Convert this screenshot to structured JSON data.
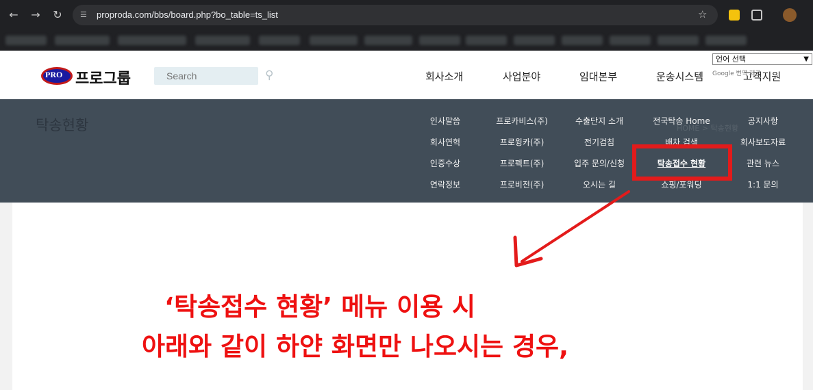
{
  "browser": {
    "url": "proproda.com/bbs/board.php?bo_table=ts_list",
    "icons": [
      "back-icon",
      "forward-icon",
      "reload-icon",
      "site-info-icon",
      "star-icon",
      "extension-icon",
      "profile-icon"
    ]
  },
  "header": {
    "logo_badge": "PRO",
    "logo_text": "프로그룹",
    "search_placeholder": "Search",
    "nav": [
      "회사소개",
      "사업분야",
      "임대본부",
      "운송시스템",
      "고객지원"
    ],
    "language_select": "언어 선택",
    "google_translate": "Google 번역 제공"
  },
  "subnav": {
    "page_title": "탁송현황",
    "breadcrumb": "HOME  >  탁송현황",
    "columns": [
      [
        "인사말씀",
        "회사연혁",
        "인증수상",
        "연락정보"
      ],
      [
        "프로카비스(주)",
        "프로윙카(주)",
        "프로펙트(주)",
        "프로비전(주)"
      ],
      [
        "수출단지 소개",
        "전기검침",
        "입주 문의/신청",
        "오시는 길"
      ],
      [
        "전국탁송 Home",
        "배차 검색",
        "탁송접수 현황",
        "쇼핑/포워딩"
      ],
      [
        "공지사항",
        "회사보도자료",
        "관련 뉴스",
        "1:1 문의"
      ]
    ],
    "active_item": "탁송접수 현황"
  },
  "annotation": {
    "line1": "‘탁송접수 현황’  메뉴 이용 시",
    "line2": "아래와 같이 하얀 화면만 나오시는 경우,",
    "color": "#ee1111"
  },
  "colors": {
    "subnav_bg": "#414d58",
    "browser_bg": "#202124",
    "highlight": "#e31b1b"
  }
}
